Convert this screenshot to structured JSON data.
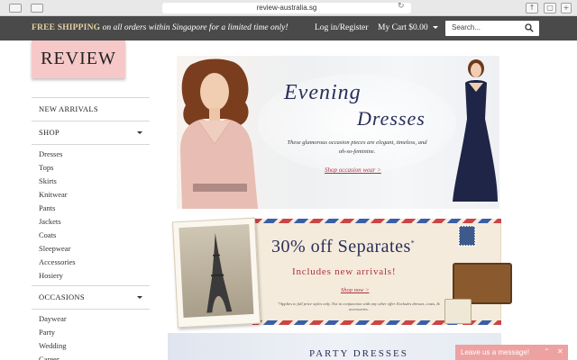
{
  "browser": {
    "url": "review-australia.sg"
  },
  "topbar": {
    "promo_bold": "FREE SHIPPING",
    "promo_italic": "on all orders within Singapore for a limited time only!",
    "login": "Log in/Register",
    "cart": "My Cart $0.00",
    "search_placeholder": "Search..."
  },
  "logo": {
    "text": "REVIEW"
  },
  "sidebar": {
    "new_arrivals": "NEW ARRIVALS",
    "shop": "SHOP",
    "shop_items": [
      "Dresses",
      "Tops",
      "Skirts",
      "Knitwear",
      "Pants",
      "Jackets",
      "Coats",
      "Sleepwear",
      "Accessories",
      "Hosiery"
    ],
    "occasions": "OCCASIONS",
    "occasion_items": [
      "Daywear",
      "Party",
      "Wedding",
      "Career"
    ]
  },
  "banner_evening": {
    "title_line1": "Evening",
    "title_line2": "Dresses",
    "description": "These glamorous occasion pieces are elegant, timeless, and oh-so-feminine.",
    "link": "Shop occasion wear >"
  },
  "banner_separates": {
    "headline": "30% off Separates",
    "asterisk": "*",
    "subline": "Includes new arrivals!",
    "link": "Shop now >",
    "fine_print": "*Applies to full price styles only. Not in conjunction with any other offer. Excludes dresses, coats, & accessories."
  },
  "banner_party": {
    "title": "PARTY DRESSES"
  },
  "chat": {
    "label": "Leave us a message!"
  },
  "colors": {
    "topbar_bg": "#4a4a4a",
    "logo_bg": "#f6c8c8",
    "accent_red": "#b03040",
    "navy": "#2a2f5a",
    "chat_bg": "#eda1a1"
  }
}
